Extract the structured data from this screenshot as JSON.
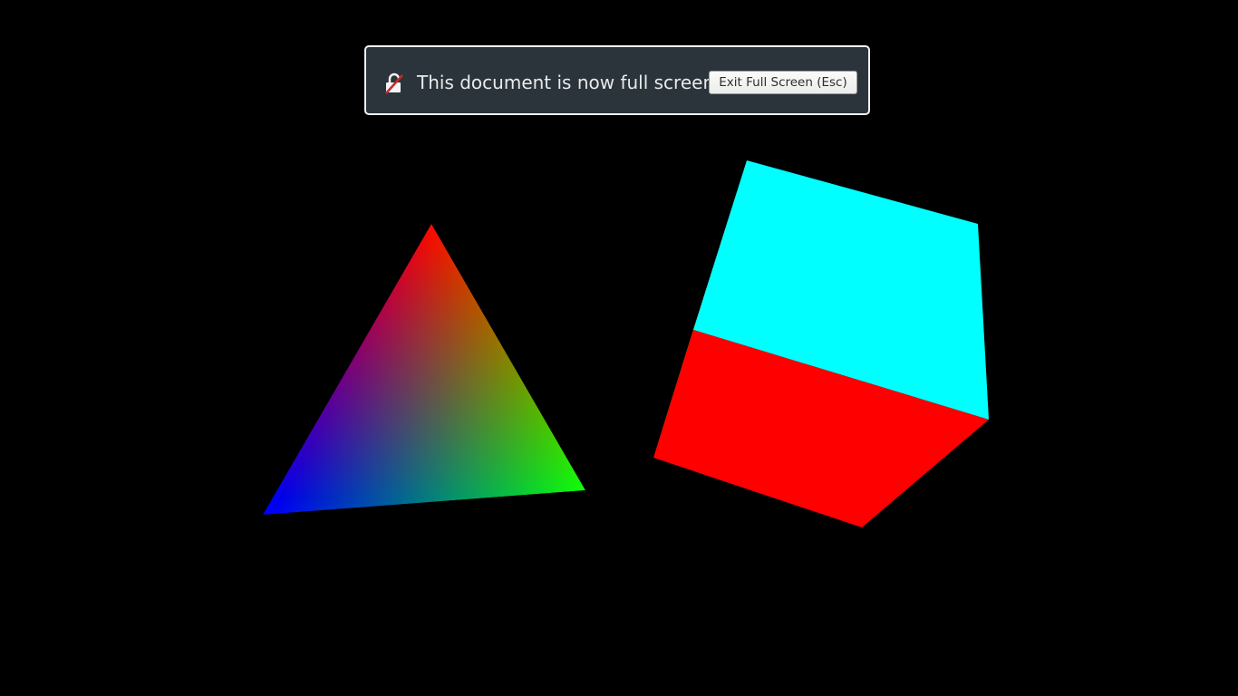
{
  "notification": {
    "message": "This document is now full screen",
    "exit_button_label": "Exit Full Screen (Esc)",
    "icon": "fullscreen-unlock-icon"
  },
  "scene": {
    "background_color": "#000000",
    "triangle": {
      "vertex_colors": [
        "#ff0000",
        "#0000ff",
        "#00ff00"
      ]
    },
    "cube": {
      "top_face_color": "#00ffff",
      "front_face_color": "#ff0000",
      "side_edge_color": "#ffff00"
    }
  },
  "colors": {
    "notice_background": "#2b343b",
    "notice_border": "#f2f2f2",
    "notice_text": "#e8eaec"
  }
}
